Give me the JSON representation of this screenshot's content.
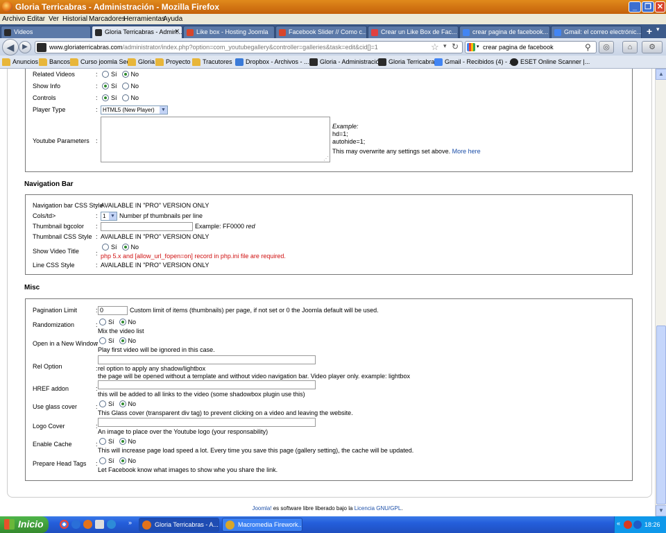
{
  "window": {
    "title": "Gloria Terricabras - Administración - Mozilla Firefox"
  },
  "menu": [
    "Archivo",
    "Editar",
    "Ver",
    "Historial",
    "Marcadores",
    "Herramientas",
    "Ayuda"
  ],
  "tabs": [
    {
      "label": "Videos",
      "icon_color": "#2a2a2a",
      "active": false
    },
    {
      "label": "Gloria Terricabras - Admin...",
      "icon_color": "#2a2a2a",
      "active": true
    },
    {
      "label": "Like box - Hosting Joomla",
      "icon_color": "#d8452b",
      "active": false
    },
    {
      "label": "Facebook Slider // Como c...",
      "icon_color": "#d8452b",
      "active": false
    },
    {
      "label": "Crear un Like Box de Fac...",
      "icon_color": "#e04040",
      "active": false
    },
    {
      "label": "crear pagina de facebook...",
      "icon_color": "#4285f4",
      "active": false
    },
    {
      "label": "Gmail: el correo electrónic...",
      "icon_color": "#4285f4",
      "active": false
    }
  ],
  "nav": {
    "url_host": "www.gloriaterricabras.com",
    "url_path": "/administrator/index.php?option=com_youtubegallery&controller=galleries&task=edit&cid[]=1",
    "search_text": "crear pagina de facebook"
  },
  "bookmarks": [
    {
      "label": "Anuncios",
      "type": "folder"
    },
    {
      "label": "Bancos",
      "type": "folder"
    },
    {
      "label": "Curso joomla Seo",
      "type": "folder"
    },
    {
      "label": "Gloria",
      "type": "folder"
    },
    {
      "label": "Proyecto",
      "type": "folder"
    },
    {
      "label": "Tracutores",
      "type": "folder"
    },
    {
      "label": "Dropbox - Archivos - ...",
      "type": "dropbox"
    },
    {
      "label": "Gloria - Administración",
      "type": "joomla"
    },
    {
      "label": "Gloria Terricabras",
      "type": "joomla"
    },
    {
      "label": "Gmail - Recibidos (4) - ...",
      "type": "gmail"
    },
    {
      "label": "ESET Online Scanner |...",
      "type": "eset"
    }
  ],
  "player": {
    "related_videos": {
      "label": "Related Videos",
      "value": "No"
    },
    "show_info": {
      "label": "Show Info",
      "value": "No"
    },
    "controls": {
      "label": "Controls",
      "value": "Sí"
    },
    "player_type": {
      "label": "Player Type",
      "value": "HTML5 (New Player)"
    },
    "youtube_params": {
      "label": "Youtube Parameters",
      "value": ""
    },
    "example_title": "Example:",
    "example_l1": "hd=1;",
    "example_l2": "autohide=1;",
    "overwrite_note": "This may overwrite any settings set above.",
    "more_here": "More here"
  },
  "radio": {
    "yes": "Sí",
    "no": "No"
  },
  "nav_section": {
    "title": "Navigation Bar",
    "css_style": {
      "label": "Navigation bar CSS Style",
      "value": "AVAILABLE IN \"PRO\" VERSION ONLY"
    },
    "cols": {
      "label": "Cols/td>",
      "value": "1",
      "hint": "Number pf thumbnails per line"
    },
    "thumb_bg": {
      "label": "Thumbnail bgcolor",
      "value": "",
      "hint": "Example: FF0000",
      "hint_red": "red"
    },
    "thumb_css": {
      "label": "Thumbnail CSS Style",
      "value": "AVAILABLE IN \"PRO\" VERSION ONLY"
    },
    "show_title": {
      "label": "Show Video Title",
      "value": "No",
      "warning": "php 5.x and [allow_url_fopen=on] record in php.ini file are required."
    },
    "line_css": {
      "label": "Line CSS Style",
      "value": "AVAILABLE IN \"PRO\" VERSION ONLY"
    }
  },
  "misc": {
    "title": "Misc",
    "pagination": {
      "label": "Pagination Limit",
      "value": "0",
      "hint": "Custom limit of items (thumbnails) per page, if not set or 0 the Joomla default will be used."
    },
    "randomization": {
      "label": "Randomization",
      "value": "No",
      "hint": "Mix the video list"
    },
    "new_window": {
      "label": "Open in a New Window",
      "value": "No",
      "hint": "Play first video will be ignored in this case."
    },
    "rel_option": {
      "label": "Rel Option",
      "value": "",
      "hint1": "rel option to apply any shadow/lightbox",
      "hint2": "the page will be opened without a template and without video navigation bar. Video player only. example: lightbox"
    },
    "href_addon": {
      "label": "HREF addon",
      "value": "",
      "hint": "this will be added to all links to the video (some shadowbox plugin use this)"
    },
    "glass_cover": {
      "label": "Use glass cover",
      "value": "No",
      "hint": "This Glass cover (transparent div tag) to prevent clicking on a video and leaving the website."
    },
    "logo_cover": {
      "label": "Logo Cover",
      "value": "",
      "hint": "An image to place over the Youtube logo (your responsability)"
    },
    "enable_cache": {
      "label": "Enable Cache",
      "value": "No",
      "hint": "This will increase page load speed a lot. Every time you save this page (gallery setting), the cache will be updated."
    },
    "head_tags": {
      "label": "Prepare Head Tags",
      "value": "No",
      "hint": "Let Facebook know what images to show whe you share the link."
    }
  },
  "footer": {
    "joomla": "Joomla!",
    "text": " es software libre liberado bajo la ",
    "license": "Licencia GNU/GPL",
    "end": "."
  },
  "taskbar": {
    "start": "Inicio",
    "tasks": [
      {
        "label": "Gloria Terricabras - A...",
        "active": true
      },
      {
        "label": "Macromedia Firework...",
        "active": false
      }
    ],
    "clock": "18:26"
  }
}
